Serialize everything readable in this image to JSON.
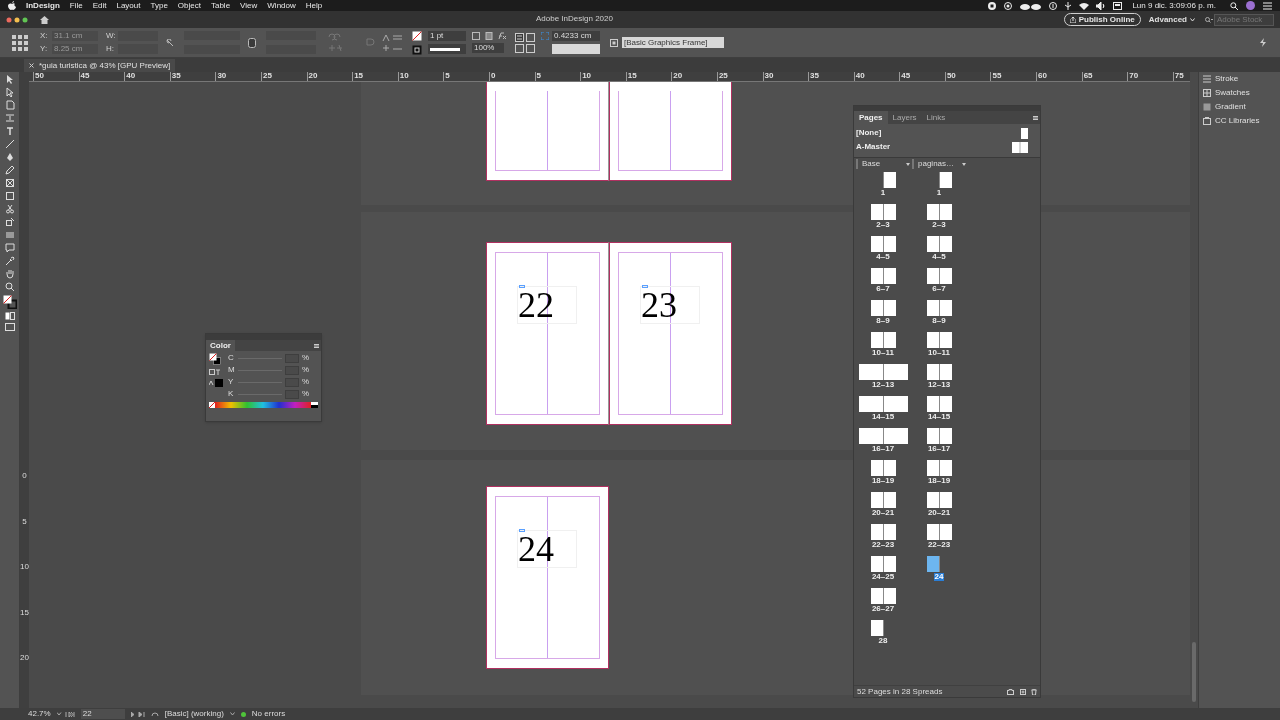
{
  "menu_bar": {
    "app": "InDesign",
    "items": [
      "File",
      "Edit",
      "Layout",
      "Type",
      "Object",
      "Table",
      "View",
      "Window",
      "Help"
    ],
    "clock": "Lun 9 dic.  3:09:06 p. m."
  },
  "app_bar": {
    "title": "Adobe InDesign 2020",
    "publish_button": "Publish Online",
    "workspace": "Advanced",
    "search": {
      "placeholder": "Adobe Stock"
    }
  },
  "control_panel": {
    "x_label": "X:",
    "x_value": "31.1 cm",
    "y_label": "Y:",
    "y_value": "8.25 cm",
    "w_label": "W:",
    "h_label": "H:",
    "stroke_weight": "1 pt",
    "scale": "100%",
    "offset": "0.4233 cm",
    "object_style": "[Basic Graphics Frame]"
  },
  "document_tab": {
    "title": "*guia turistica @ 43% [GPU Preview]"
  },
  "ruler": {
    "horizontal": [
      "50",
      "45",
      "40",
      "35",
      "30",
      "25",
      "20",
      "15",
      "10",
      "5",
      "0",
      "5",
      "10",
      "15",
      "20",
      "25",
      "30",
      "35",
      "40",
      "45",
      "50",
      "55",
      "60",
      "65",
      "70",
      "75"
    ],
    "vertical": [
      "0",
      "5",
      "10",
      "15",
      "20"
    ]
  },
  "spreads": [
    {
      "kind": "spread"
    },
    {
      "kind": "spread",
      "numbers": [
        "22",
        "23"
      ]
    },
    {
      "kind": "single",
      "numbers": [
        "24"
      ]
    }
  ],
  "color_panel": {
    "title": "Color",
    "channels": [
      {
        "label": "C",
        "unit": "%"
      },
      {
        "label": "M",
        "unit": "%"
      },
      {
        "label": "Y",
        "unit": "%"
      },
      {
        "label": "K",
        "unit": "%"
      }
    ]
  },
  "pages_panel": {
    "tabs": [
      {
        "label": "Pages",
        "selected": true
      },
      {
        "label": "Layers",
        "selected": false
      },
      {
        "label": "Links",
        "selected": false
      }
    ],
    "masters": [
      "[None]",
      "A-Master"
    ],
    "columns": [
      {
        "label": "Base",
        "spreads": [
          {
            "label": "1",
            "kind": "right",
            "selected": false
          },
          {
            "label": "2–3",
            "kind": "spread",
            "selected": false
          },
          {
            "label": "4–5",
            "kind": "spread",
            "selected": false
          },
          {
            "label": "6–7",
            "kind": "spread",
            "selected": false
          },
          {
            "label": "8–9",
            "kind": "spread",
            "selected": false
          },
          {
            "label": "10–11",
            "kind": "spread",
            "selected": false
          },
          {
            "label": "12–13",
            "kind": "wide",
            "selected": false
          },
          {
            "label": "14–15",
            "kind": "wide",
            "selected": false
          },
          {
            "label": "16–17",
            "kind": "wide",
            "selected": false
          },
          {
            "label": "18–19",
            "kind": "spread",
            "selected": false
          },
          {
            "label": "20–21",
            "kind": "spread",
            "selected": false
          },
          {
            "label": "22–23",
            "kind": "spread",
            "selected": false
          },
          {
            "label": "24–25",
            "kind": "spread",
            "selected": false
          },
          {
            "label": "26–27",
            "kind": "spread",
            "selected": false
          },
          {
            "label": "28",
            "kind": "left",
            "selected": false
          }
        ]
      },
      {
        "label": "paginas…",
        "spreads": [
          {
            "label": "1",
            "kind": "right",
            "selected": false
          },
          {
            "label": "2–3",
            "kind": "spread",
            "selected": false
          },
          {
            "label": "4–5",
            "kind": "spread",
            "selected": false
          },
          {
            "label": "6–7",
            "kind": "spread",
            "selected": false
          },
          {
            "label": "8–9",
            "kind": "spread",
            "selected": false
          },
          {
            "label": "10–11",
            "kind": "spread",
            "selected": false
          },
          {
            "label": "12–13",
            "kind": "spread",
            "selected": false
          },
          {
            "label": "14–15",
            "kind": "spread",
            "selected": false
          },
          {
            "label": "16–17",
            "kind": "spread",
            "selected": false
          },
          {
            "label": "18–19",
            "kind": "spread",
            "selected": false
          },
          {
            "label": "20–21",
            "kind": "spread",
            "selected": false
          },
          {
            "label": "22–23",
            "kind": "spread",
            "selected": false
          },
          {
            "label": "24",
            "kind": "left",
            "selected": true
          }
        ]
      }
    ],
    "footer": "52 Pages in 28 Spreads"
  },
  "right_dock": [
    "Stroke",
    "Swatches",
    "Gradient",
    "CC Libraries"
  ],
  "status_bar": {
    "zoom": "42.7%",
    "page": "22",
    "preflight_profile": "[Basic] (working)",
    "preflight_status": "No errors"
  }
}
